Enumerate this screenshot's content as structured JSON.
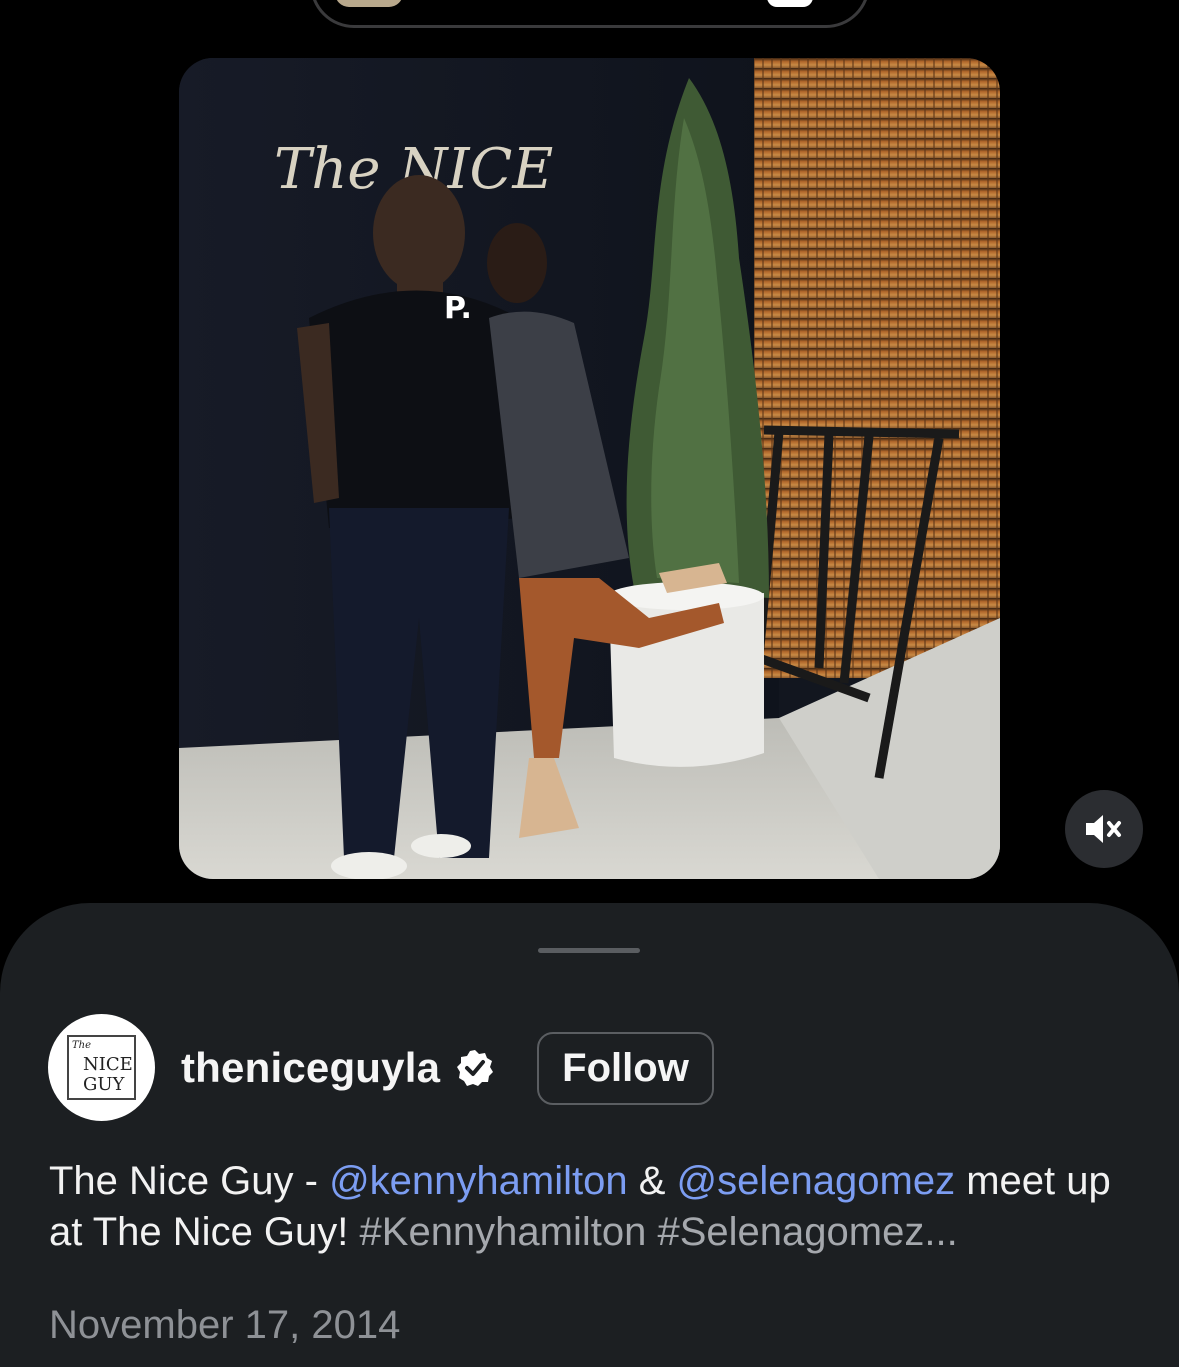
{
  "top_pill": {
    "present": true
  },
  "post": {
    "image_alt": "Photo of two people posing in front of The Nice Guy restaurant sign",
    "sign_text": "The NICE",
    "shirt_letter": "P."
  },
  "controls": {
    "mute_icon": "speaker-muted-icon"
  },
  "sheet": {
    "account": {
      "avatar_line1": "The",
      "avatar_line2": "NICE",
      "avatar_line3": "GUY",
      "username": "theniceguyla",
      "verified_icon": "verified-badge-icon",
      "follow_label": "Follow"
    },
    "caption": {
      "part1": "The Nice Guy - ",
      "mention1": "@kennyhamilton",
      "part2": " & ",
      "mention2": "@selenagomez",
      "part3": " meet up at The Nice Guy! ",
      "hashtags": "#Kennyhamilton #Selenagomez..."
    },
    "date": "November 17, 2014"
  },
  "colors": {
    "background": "#000000",
    "sheet": "#1c1f22",
    "mention": "#7c9df2",
    "hashtag": "#a5a8ad",
    "date": "#8e9196"
  }
}
